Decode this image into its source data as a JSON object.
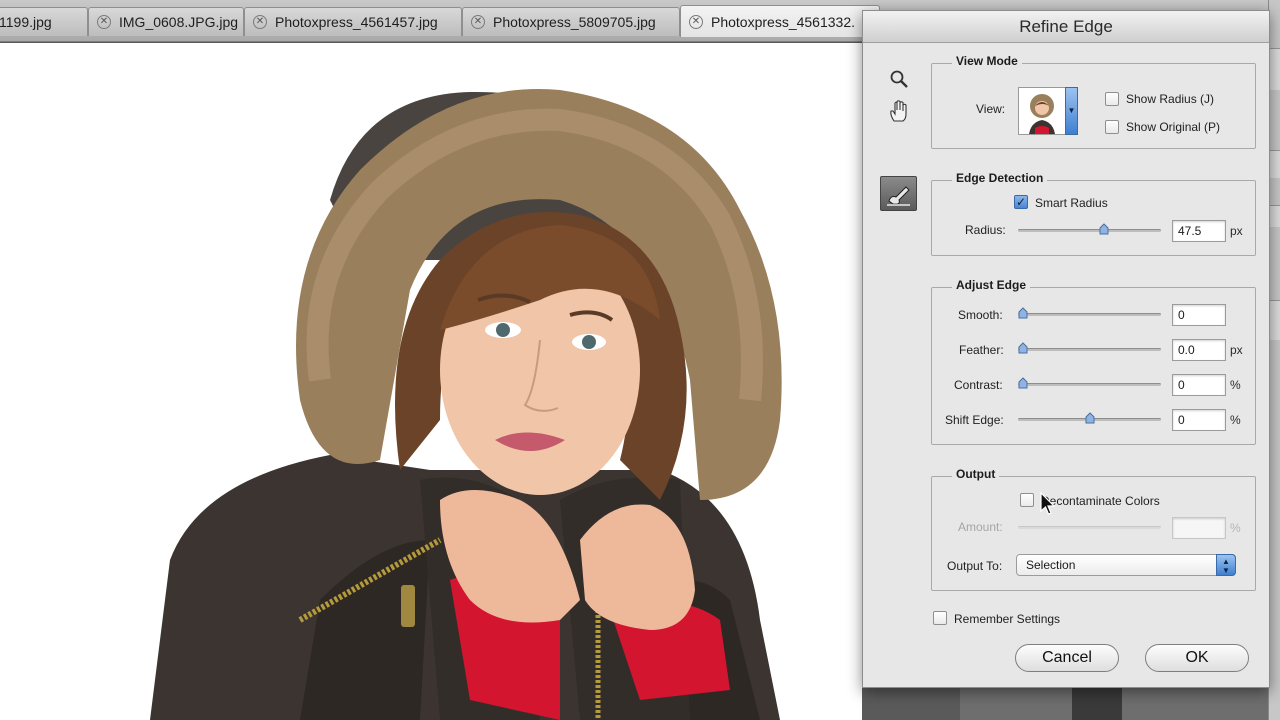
{
  "tabs": [
    {
      "label": "1199.jpg",
      "active": false
    },
    {
      "label": "IMG_0608.JPG.jpg",
      "active": false
    },
    {
      "label": "Photoxpress_4561457.jpg",
      "active": false
    },
    {
      "label": "Photoxpress_5809705.jpg",
      "active": false
    },
    {
      "label": "Photoxpress_4561332.",
      "active": true
    }
  ],
  "dialog": {
    "title": "Refine Edge",
    "tools": [
      "zoom-icon",
      "hand-icon",
      "refine-radius-brush-icon"
    ],
    "view_mode": {
      "title": "View Mode",
      "view_label": "View:",
      "show_radius": {
        "label": "Show Radius (J)",
        "checked": false
      },
      "show_original": {
        "label": "Show Original (P)",
        "checked": false
      }
    },
    "edge_detection": {
      "title": "Edge Detection",
      "smart_radius": {
        "label": "Smart Radius",
        "checked": true
      },
      "radius": {
        "label": "Radius:",
        "value": "47.5",
        "unit": "px",
        "level": 0.61
      }
    },
    "adjust_edge": {
      "title": "Adjust Edge",
      "smooth": {
        "label": "Smooth:",
        "value": "0",
        "unit": "",
        "level": 0.0
      },
      "feather": {
        "label": "Feather:",
        "value": "0.0",
        "unit": "px",
        "level": 0.0
      },
      "contrast": {
        "label": "Contrast:",
        "value": "0",
        "unit": "%",
        "level": 0.0
      },
      "shift_edge": {
        "label": "Shift Edge:",
        "value": "0",
        "unit": "%",
        "level": 0.5
      }
    },
    "output": {
      "title": "Output",
      "decontaminate": {
        "label": "Decontaminate Colors",
        "checked": false
      },
      "amount": {
        "label": "Amount:",
        "value": "",
        "unit": "%"
      },
      "output_to": {
        "label": "Output To:",
        "value": "Selection"
      }
    },
    "remember": {
      "label": "Remember Settings",
      "checked": false
    },
    "cancel_label": "Cancel",
    "ok_label": "OK"
  },
  "colors": {
    "accent": "#4a86d4",
    "dialog_bg": "#e7e7e7",
    "canvas_bg": "#ffffff"
  }
}
